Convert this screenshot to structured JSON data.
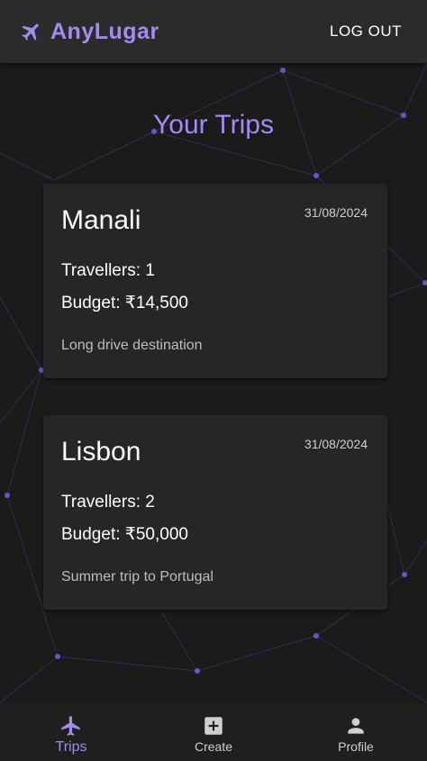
{
  "header": {
    "app_name": "AnyLugar",
    "logout_label": "LOG OUT",
    "brand_icon": "airplane-icon"
  },
  "page": {
    "title": "Your Trips"
  },
  "trips": [
    {
      "name": "Manali",
      "date": "31/08/2024",
      "travellers": "Travellers: 1",
      "budget": "Budget: ₹14,500",
      "description": "Long drive destination"
    },
    {
      "name": "Lisbon",
      "date": "31/08/2024",
      "travellers": "Travellers: 2",
      "budget": "Budget: ₹50,000",
      "description": "Summer trip to Portugal"
    }
  ],
  "bottom_nav": {
    "items": [
      {
        "label": "Trips",
        "icon": "airplane-icon",
        "active": true
      },
      {
        "label": "Create",
        "icon": "add-box-icon",
        "active": false
      },
      {
        "label": "Profile",
        "icon": "person-icon",
        "active": false
      }
    ]
  },
  "colors": {
    "accent": "#a58af2",
    "background": "#1b1b1b",
    "app_bar": "#2b2b2b",
    "card": "#262626",
    "network": "#6a55c8"
  }
}
